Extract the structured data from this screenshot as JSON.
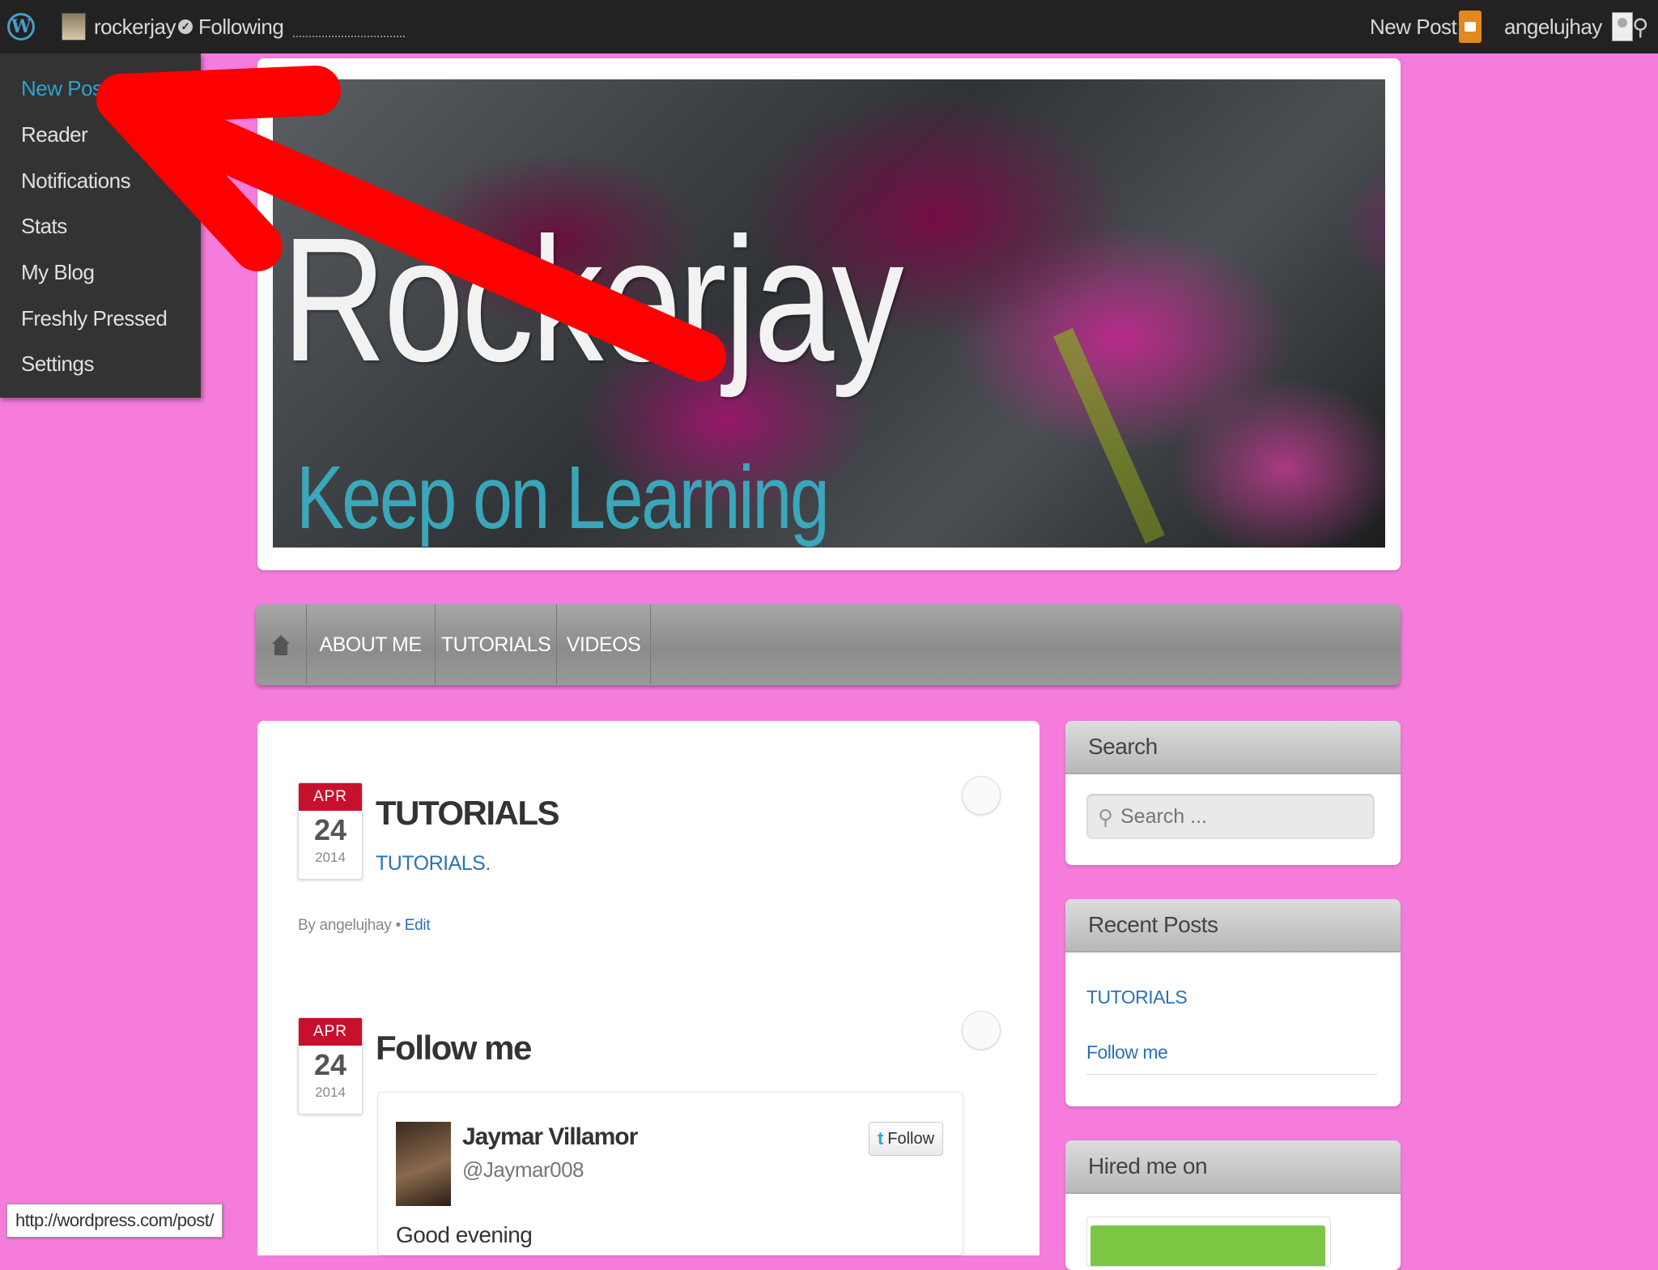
{
  "admin_bar": {
    "blog_name": "rockerjay",
    "following": "Following",
    "new_post": "New Post",
    "username": "angelujhay"
  },
  "dropdown": {
    "items": [
      "New Post",
      "Reader",
      "Notifications",
      "Stats",
      "My Blog",
      "Freshly Pressed",
      "Settings"
    ],
    "active_item": "New Post"
  },
  "header": {
    "title": "Rockerjay",
    "tagline": "Keep on Learning"
  },
  "nav": {
    "items": [
      "ABOUT ME",
      "TUTORIALS",
      "VIDEOS"
    ]
  },
  "posts": [
    {
      "month": "APR",
      "day": "24",
      "year": "2014",
      "title": "TUTORIALS",
      "link": "TUTORIALS.",
      "byline_prefix": "By angelujhay •",
      "edit": "Edit"
    },
    {
      "month": "APR",
      "day": "24",
      "year": "2014",
      "title": "Follow me"
    }
  ],
  "tweet": {
    "name": "Jaymar Villamor",
    "handle": "@Jaymar008",
    "follow": "Follow",
    "text": "Good evening"
  },
  "sidebar": {
    "search": {
      "title": "Search",
      "placeholder": "Search ..."
    },
    "recent": {
      "title": "Recent Posts",
      "items": [
        "TUTORIALS",
        "Follow me"
      ]
    },
    "hired": {
      "title": "Hired me on"
    }
  },
  "status_url": "http://wordpress.com/post/",
  "colors": {
    "background": "#f57cdb",
    "arrow": "#ff0000",
    "link": "#2a72b8",
    "active_menu": "#2ea2cc"
  }
}
